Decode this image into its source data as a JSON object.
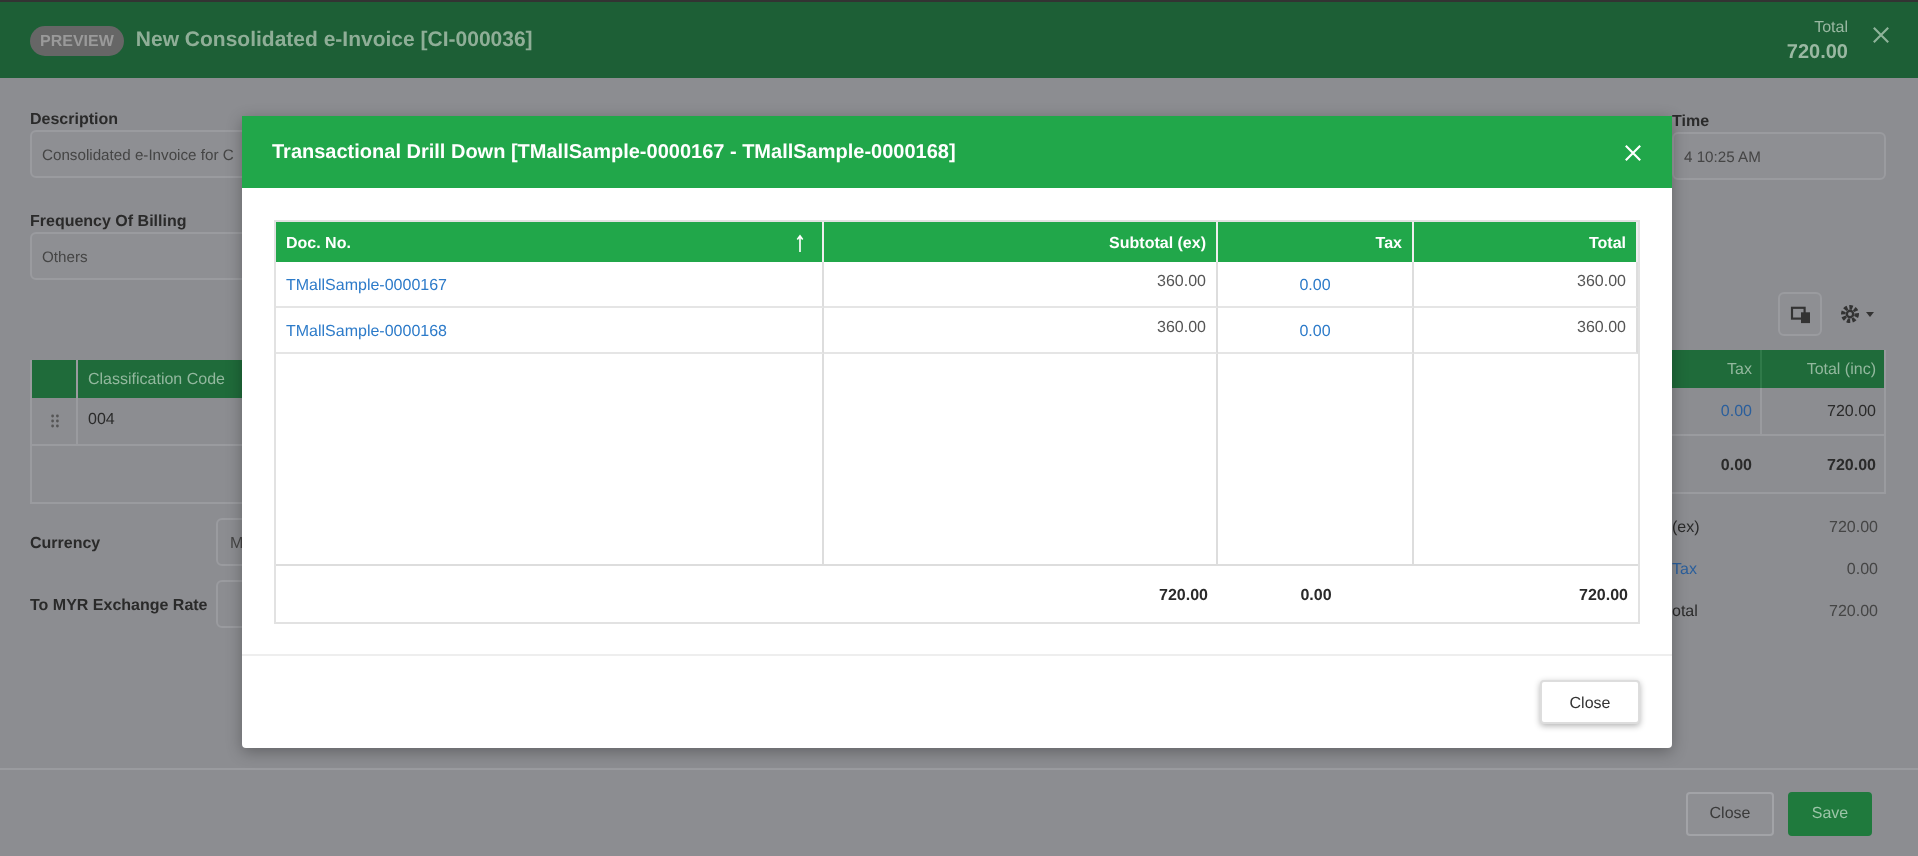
{
  "header": {
    "badge": "PREVIEW",
    "title": "New Consolidated e-Invoice [CI-000036]",
    "total_label": "Total",
    "total_value": "720.00"
  },
  "form": {
    "fields": [
      {
        "label": "Description",
        "value": "Consolidated e-Invoice for C"
      },
      {
        "label": "Frequency Of Billing",
        "value": "Others"
      }
    ],
    "date_field": {
      "label": "Time",
      "value": "4 10:25 AM"
    }
  },
  "lines": {
    "left_column": "Classification Code",
    "right_columns": [
      "Tax",
      "Total (inc)"
    ],
    "rows": [
      {
        "code": "004",
        "tax": "0.00",
        "total": "720.00"
      }
    ],
    "footer": {
      "tax": "0.00",
      "total": "720.00"
    }
  },
  "currency": [
    {
      "label": "Currency",
      "value": "M"
    },
    {
      "label": "To MYR Exchange Rate"
    }
  ],
  "summary": [
    {
      "label": "(ex)",
      "value": "720.00",
      "kind": "text"
    },
    {
      "label": "Tax",
      "value": "0.00",
      "kind": "link"
    },
    {
      "label": "otal",
      "value": "720.00",
      "kind": "text"
    }
  ],
  "footer_buttons": [
    {
      "label": "Close",
      "kind": "secondary"
    },
    {
      "label": "Save",
      "kind": "primary"
    }
  ],
  "dialog": {
    "title": "Transactional Drill Down [TMallSample-0000167 - TMallSample-0000168]",
    "columns": [
      {
        "label": "Doc. No.",
        "sorted": true
      },
      {
        "label": "Subtotal (ex)",
        "sorted": false
      },
      {
        "label": "Tax",
        "sorted": false
      },
      {
        "label": "Total",
        "sorted": false
      }
    ],
    "rows": [
      {
        "doc": "TMallSample-0000167",
        "subtotal": "360.00",
        "tax": "0.00",
        "total": "360.00"
      },
      {
        "doc": "TMallSample-0000168",
        "subtotal": "360.00",
        "tax": "0.00",
        "total": "360.00"
      }
    ],
    "totals": {
      "subtotal": "720.00",
      "tax": "0.00",
      "total": "720.00"
    },
    "button": "Close"
  }
}
